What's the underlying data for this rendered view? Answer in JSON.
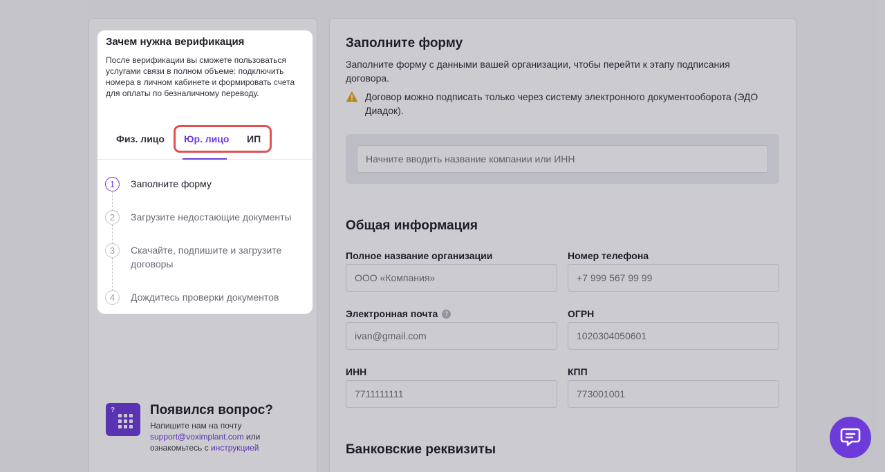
{
  "form": {
    "title": "Заполните форму",
    "description": "Заполните форму с данными вашей организации, чтобы перейти к этапу подписания договора.",
    "warning": "Договор можно подписать только через систему электронного документооборота (ЭДО Диадок).",
    "search_placeholder": "Начните вводить название компании или ИНН"
  },
  "general": {
    "title": "Общая информация",
    "org_name_label": "Полное название организации",
    "org_name_placeholder": "ООО «Компания»",
    "phone_label": "Номер телефона",
    "phone_placeholder": "+7 999 567 99 99",
    "email_label": "Электронная почта",
    "email_placeholder": "ivan@gmail.com",
    "ogrn_label": "ОГРН",
    "ogrn_placeholder": "1020304050601",
    "inn_label": "ИНН",
    "inn_placeholder": "7711111111",
    "kpp_label": "КПП",
    "kpp_placeholder": "773001001"
  },
  "bank": {
    "title": "Банковские реквизиты"
  },
  "verification": {
    "title": "Зачем нужна верификация",
    "description": "После верификации вы сможете пользоваться услугами связи в полном объеме: подключить номера в личном кабинете и формировать счета для оплаты по безналичному переводу.",
    "tabs": [
      {
        "label": "Физ. лицо",
        "active": false
      },
      {
        "label": "Юр. лицо",
        "active": true
      },
      {
        "label": "ИП",
        "active": false
      }
    ],
    "steps": [
      {
        "num": "1",
        "label": "Заполните форму",
        "active": true
      },
      {
        "num": "2",
        "label": "Загрузите недостающие документы",
        "active": false
      },
      {
        "num": "3",
        "label": "Скачайте, подпишите и загрузите договоры",
        "active": false
      },
      {
        "num": "4",
        "label": "Дождитесь проверки документов",
        "active": false
      }
    ]
  },
  "help": {
    "title": "Появился вопрос?",
    "line1": "Напишите нам на почту",
    "email": "support@voximplant.com",
    "or": " или",
    "line3": "ознакомьтесь с ",
    "instructions": "инструкцией"
  },
  "icons": {
    "warning": "warning-icon",
    "help": "question-icon",
    "chat": "chat-icon"
  },
  "colors": {
    "accent": "#6d3bd9",
    "highlight": "#e25050",
    "warning": "#e8a317"
  }
}
